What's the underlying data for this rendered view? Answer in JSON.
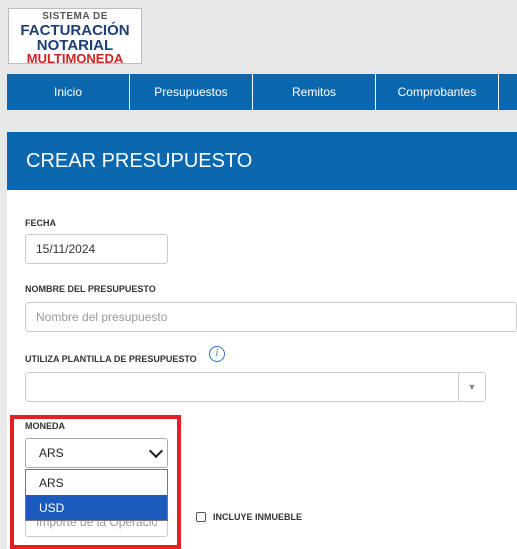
{
  "logo": {
    "line1": "SISTEMA DE",
    "line2": "FACTURACIÓN",
    "line3": "NOTARIAL",
    "line4": "MULTIMONEDA"
  },
  "nav": {
    "items": [
      "Inicio",
      "Presupuestos",
      "Remitos",
      "Comprobantes"
    ]
  },
  "panel": {
    "title": "CREAR PRESUPUESTO"
  },
  "form": {
    "fecha_label": "FECHA",
    "fecha_value": "15/11/2024",
    "nombre_label": "NOMBRE DEL PRESUPUESTO",
    "nombre_placeholder": "Nombre del presupuesto",
    "plantilla_label": "UTILIZA PLANTILLA DE PRESUPUESTO",
    "moneda_label": "MONEDA",
    "moneda_value": "ARS",
    "moneda_options": [
      "ARS",
      "USD"
    ],
    "importe_placeholder": "Importe de la Operació",
    "incluye_label": "INCLUYE INMUEBLE"
  },
  "colors": {
    "brand": "#0b68ae",
    "highlight": "#e3201f",
    "selected": "#1a5bbd"
  }
}
